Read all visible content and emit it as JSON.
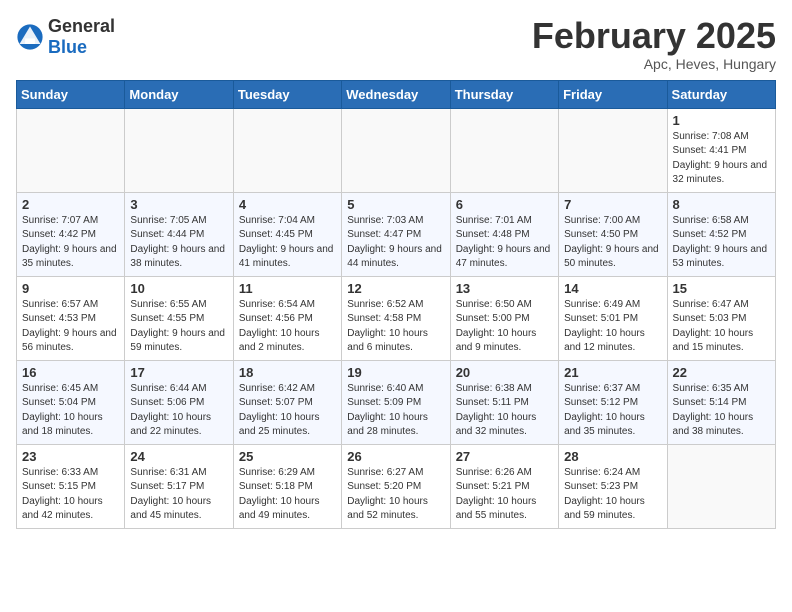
{
  "header": {
    "logo_general": "General",
    "logo_blue": "Blue",
    "month_year": "February 2025",
    "location": "Apc, Heves, Hungary"
  },
  "weekdays": [
    "Sunday",
    "Monday",
    "Tuesday",
    "Wednesday",
    "Thursday",
    "Friday",
    "Saturday"
  ],
  "weeks": [
    [
      {
        "day": "",
        "info": ""
      },
      {
        "day": "",
        "info": ""
      },
      {
        "day": "",
        "info": ""
      },
      {
        "day": "",
        "info": ""
      },
      {
        "day": "",
        "info": ""
      },
      {
        "day": "",
        "info": ""
      },
      {
        "day": "1",
        "info": "Sunrise: 7:08 AM\nSunset: 4:41 PM\nDaylight: 9 hours and 32 minutes."
      }
    ],
    [
      {
        "day": "2",
        "info": "Sunrise: 7:07 AM\nSunset: 4:42 PM\nDaylight: 9 hours and 35 minutes."
      },
      {
        "day": "3",
        "info": "Sunrise: 7:05 AM\nSunset: 4:44 PM\nDaylight: 9 hours and 38 minutes."
      },
      {
        "day": "4",
        "info": "Sunrise: 7:04 AM\nSunset: 4:45 PM\nDaylight: 9 hours and 41 minutes."
      },
      {
        "day": "5",
        "info": "Sunrise: 7:03 AM\nSunset: 4:47 PM\nDaylight: 9 hours and 44 minutes."
      },
      {
        "day": "6",
        "info": "Sunrise: 7:01 AM\nSunset: 4:48 PM\nDaylight: 9 hours and 47 minutes."
      },
      {
        "day": "7",
        "info": "Sunrise: 7:00 AM\nSunset: 4:50 PM\nDaylight: 9 hours and 50 minutes."
      },
      {
        "day": "8",
        "info": "Sunrise: 6:58 AM\nSunset: 4:52 PM\nDaylight: 9 hours and 53 minutes."
      }
    ],
    [
      {
        "day": "9",
        "info": "Sunrise: 6:57 AM\nSunset: 4:53 PM\nDaylight: 9 hours and 56 minutes."
      },
      {
        "day": "10",
        "info": "Sunrise: 6:55 AM\nSunset: 4:55 PM\nDaylight: 9 hours and 59 minutes."
      },
      {
        "day": "11",
        "info": "Sunrise: 6:54 AM\nSunset: 4:56 PM\nDaylight: 10 hours and 2 minutes."
      },
      {
        "day": "12",
        "info": "Sunrise: 6:52 AM\nSunset: 4:58 PM\nDaylight: 10 hours and 6 minutes."
      },
      {
        "day": "13",
        "info": "Sunrise: 6:50 AM\nSunset: 5:00 PM\nDaylight: 10 hours and 9 minutes."
      },
      {
        "day": "14",
        "info": "Sunrise: 6:49 AM\nSunset: 5:01 PM\nDaylight: 10 hours and 12 minutes."
      },
      {
        "day": "15",
        "info": "Sunrise: 6:47 AM\nSunset: 5:03 PM\nDaylight: 10 hours and 15 minutes."
      }
    ],
    [
      {
        "day": "16",
        "info": "Sunrise: 6:45 AM\nSunset: 5:04 PM\nDaylight: 10 hours and 18 minutes."
      },
      {
        "day": "17",
        "info": "Sunrise: 6:44 AM\nSunset: 5:06 PM\nDaylight: 10 hours and 22 minutes."
      },
      {
        "day": "18",
        "info": "Sunrise: 6:42 AM\nSunset: 5:07 PM\nDaylight: 10 hours and 25 minutes."
      },
      {
        "day": "19",
        "info": "Sunrise: 6:40 AM\nSunset: 5:09 PM\nDaylight: 10 hours and 28 minutes."
      },
      {
        "day": "20",
        "info": "Sunrise: 6:38 AM\nSunset: 5:11 PM\nDaylight: 10 hours and 32 minutes."
      },
      {
        "day": "21",
        "info": "Sunrise: 6:37 AM\nSunset: 5:12 PM\nDaylight: 10 hours and 35 minutes."
      },
      {
        "day": "22",
        "info": "Sunrise: 6:35 AM\nSunset: 5:14 PM\nDaylight: 10 hours and 38 minutes."
      }
    ],
    [
      {
        "day": "23",
        "info": "Sunrise: 6:33 AM\nSunset: 5:15 PM\nDaylight: 10 hours and 42 minutes."
      },
      {
        "day": "24",
        "info": "Sunrise: 6:31 AM\nSunset: 5:17 PM\nDaylight: 10 hours and 45 minutes."
      },
      {
        "day": "25",
        "info": "Sunrise: 6:29 AM\nSunset: 5:18 PM\nDaylight: 10 hours and 49 minutes."
      },
      {
        "day": "26",
        "info": "Sunrise: 6:27 AM\nSunset: 5:20 PM\nDaylight: 10 hours and 52 minutes."
      },
      {
        "day": "27",
        "info": "Sunrise: 6:26 AM\nSunset: 5:21 PM\nDaylight: 10 hours and 55 minutes."
      },
      {
        "day": "28",
        "info": "Sunrise: 6:24 AM\nSunset: 5:23 PM\nDaylight: 10 hours and 59 minutes."
      },
      {
        "day": "",
        "info": ""
      }
    ]
  ]
}
